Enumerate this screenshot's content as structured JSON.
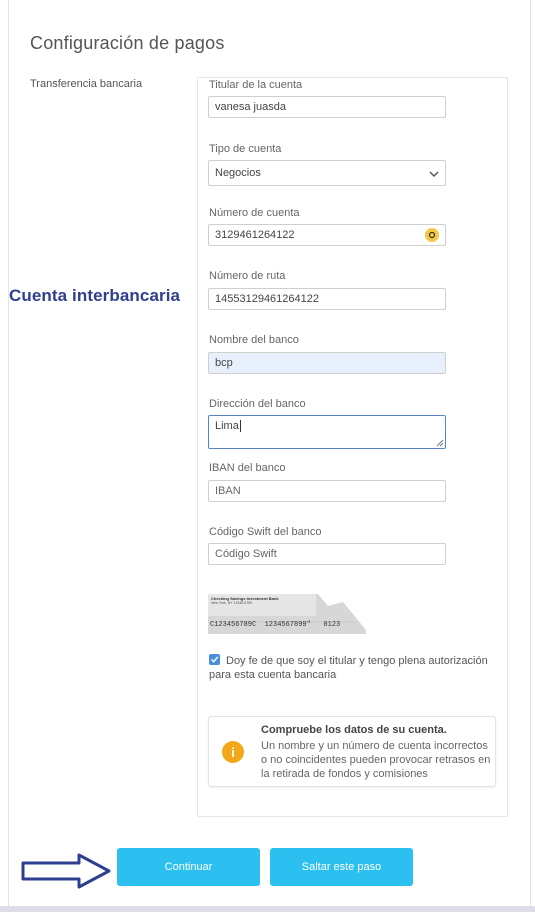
{
  "page": {
    "title": "Configuración de pagos",
    "section_label": "Transferencia bancaria"
  },
  "annotation": {
    "text": "Cuenta interbancaria",
    "color": "#2e3f8f"
  },
  "fields": {
    "account_holder": {
      "label": "Titular de la cuenta",
      "value": "vanesa juasda"
    },
    "account_type": {
      "label": "Tipo de cuenta",
      "value": "Negocios"
    },
    "account_number": {
      "label": "Número de cuenta",
      "value": "3129461264122"
    },
    "routing_number": {
      "label": "Número de ruta",
      "value": "14553129461264122"
    },
    "bank_name": {
      "label": "Nombre del banco",
      "value": "bcp"
    },
    "bank_address": {
      "label": "Dirección del banco",
      "value": "Lima"
    },
    "iban": {
      "label": "IBAN del banco",
      "placeholder": "IBAN"
    },
    "swift": {
      "label": "Código Swift del banco",
      "placeholder": "Código Swift"
    }
  },
  "check_image": {
    "bank_name": "Checking Savings Investment Bank",
    "bank_city": "New York, NY 12345-6789",
    "micr_line": "C123456789C  1234567899\"   0123"
  },
  "consent": {
    "checked": true,
    "text": "Doy fe de que soy el titular y tengo plena autorización para esta cuenta bancaria"
  },
  "notice": {
    "title": "Compruebe los datos de su cuenta.",
    "body": "Un nombre y un número de cuenta incorrectos o no coincidentes pueden provocar retrasos en la retirada de fondos y comisiones",
    "icon": "info-icon",
    "icon_glyph": "i"
  },
  "buttons": {
    "continue": "Continuar",
    "skip": "Saltar este paso"
  },
  "colors": {
    "primary_button": "#2bc0f0",
    "info_icon": "#f3a81b",
    "checkbox": "#4a90d9",
    "arrow": "#2e3f8f"
  }
}
